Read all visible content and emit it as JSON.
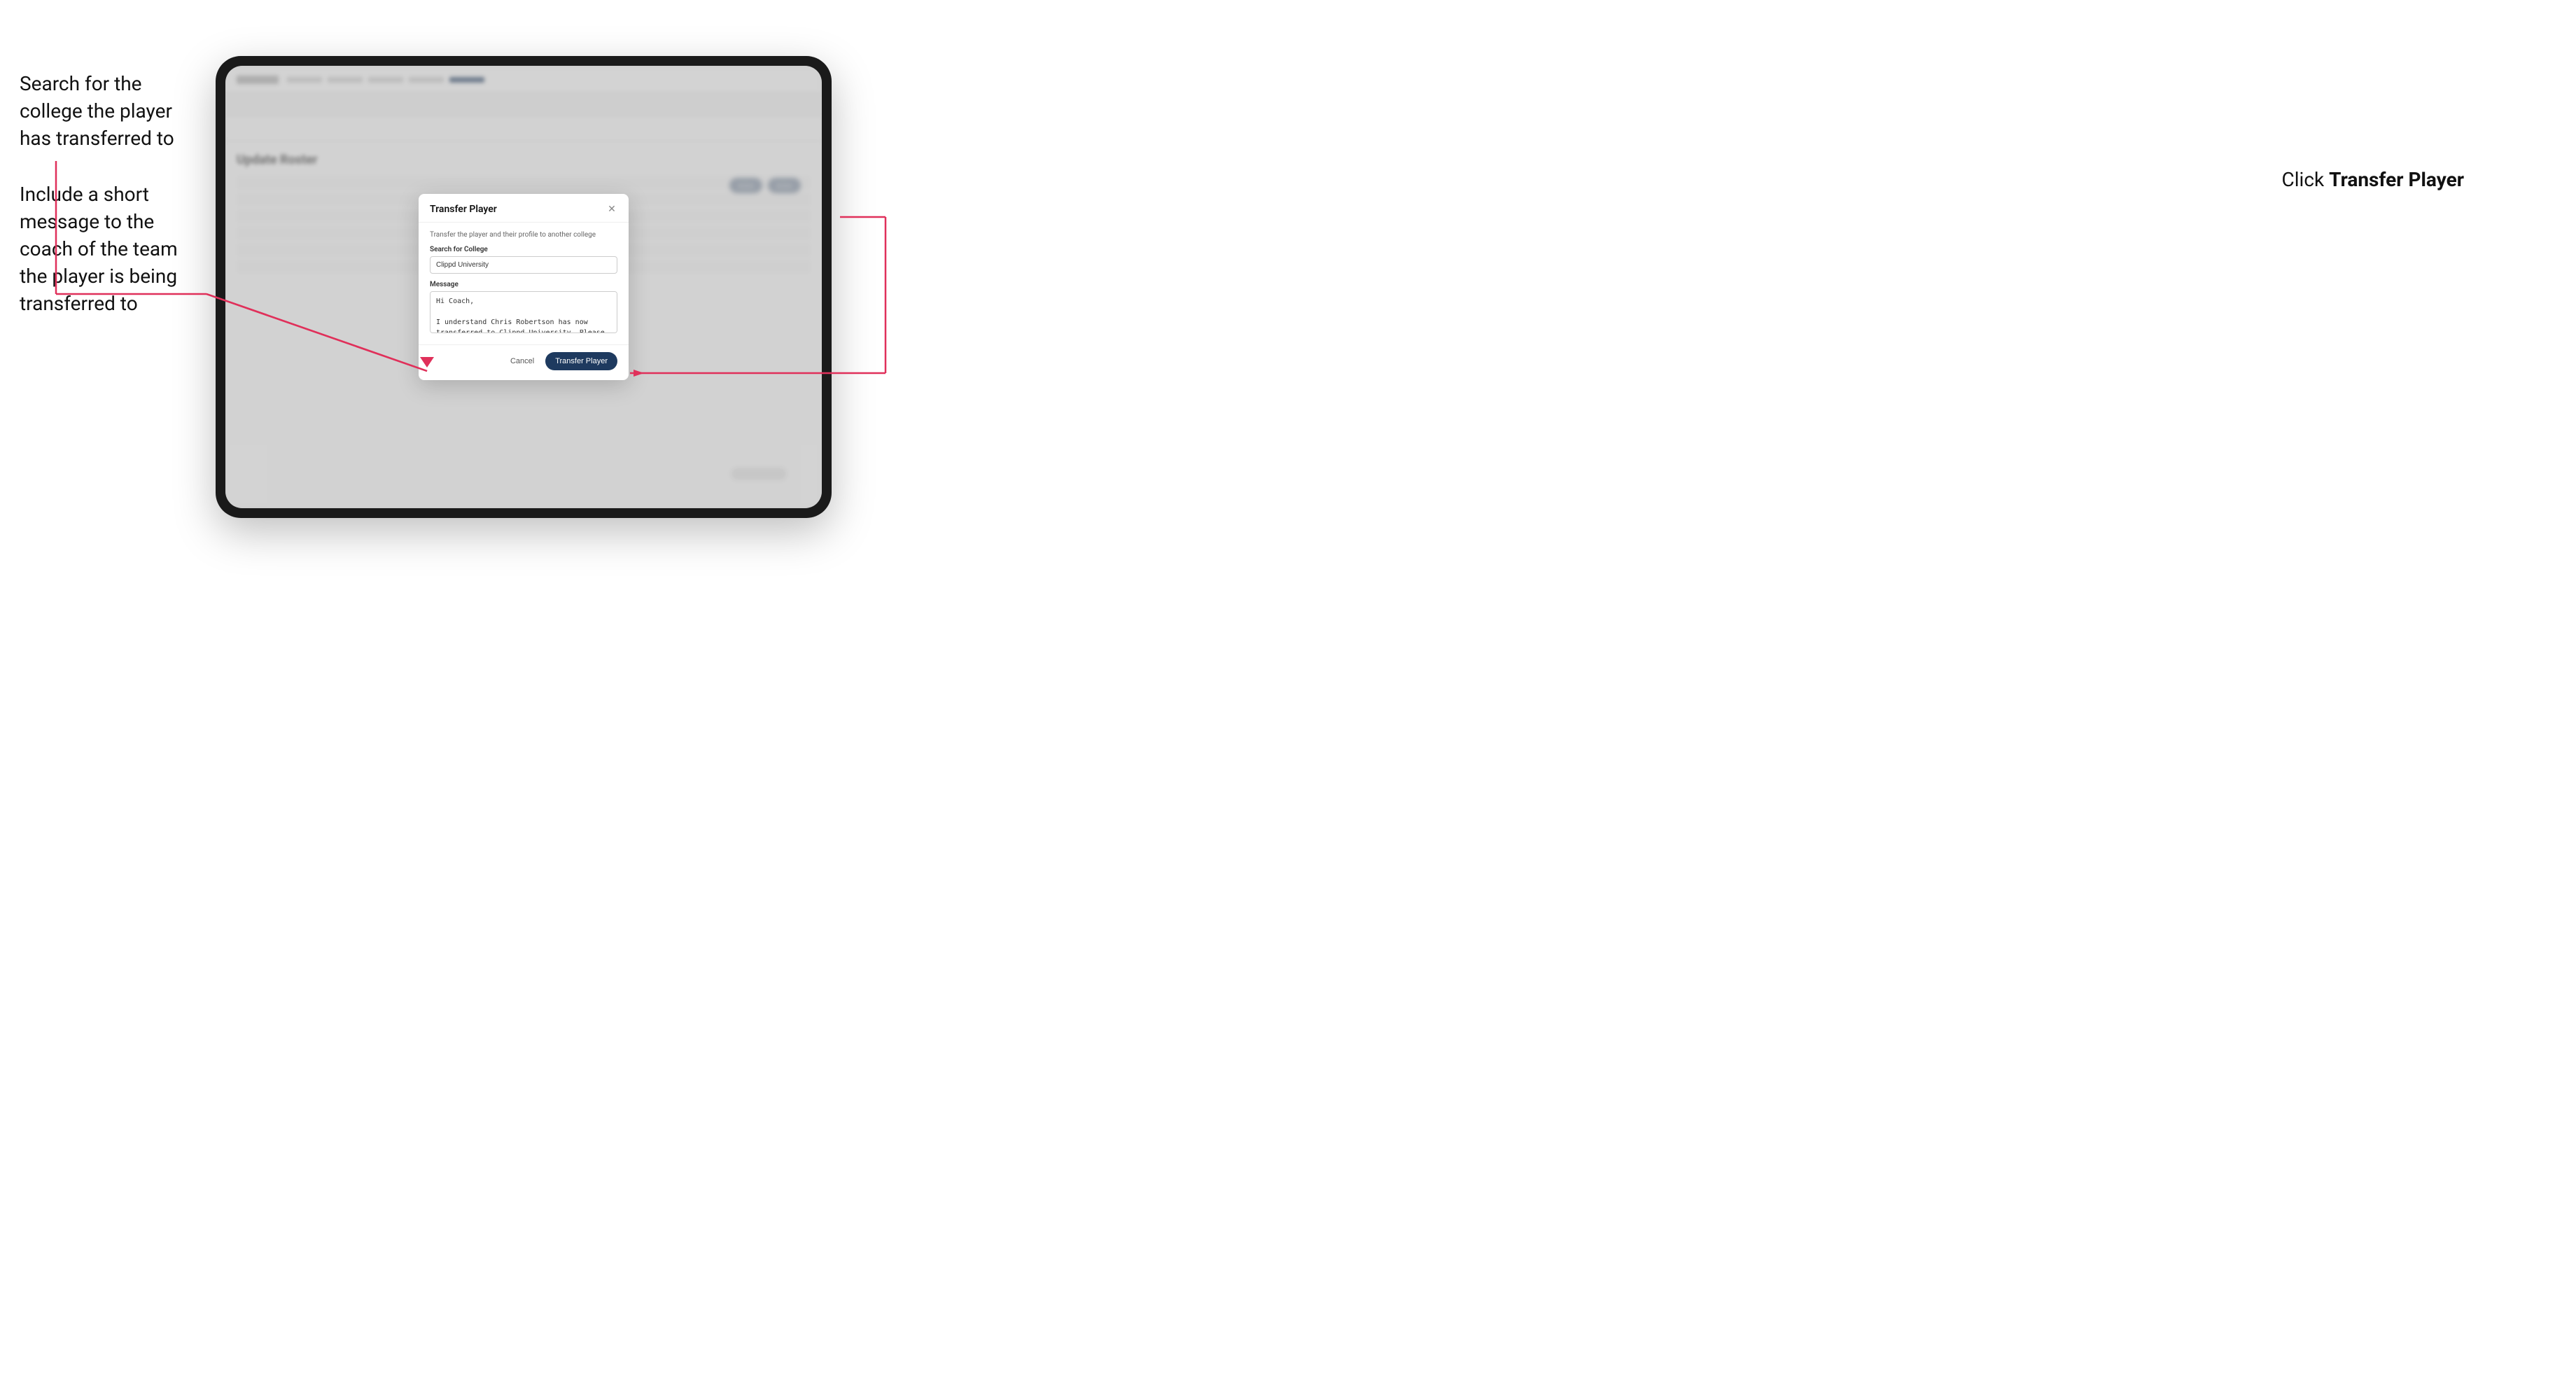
{
  "annotations": {
    "left_top": "Search for the college the player has transferred to",
    "left_bottom": "Include a short message to the coach of the team the player is being transferred to",
    "right": "Click ",
    "right_bold": "Transfer Player"
  },
  "modal": {
    "title": "Transfer Player",
    "subtitle": "Transfer the player and their profile to another college",
    "search_label": "Search for College",
    "search_value": "Clippd University",
    "message_label": "Message",
    "message_value": "Hi Coach,\n\nI understand Chris Robertson has now transferred to Clippd University. Please accept this transfer request when you can.",
    "cancel_label": "Cancel",
    "transfer_label": "Transfer Player"
  },
  "app": {
    "title": "Update Roster",
    "rows": [
      "",
      "",
      "",
      "",
      "",
      ""
    ]
  }
}
